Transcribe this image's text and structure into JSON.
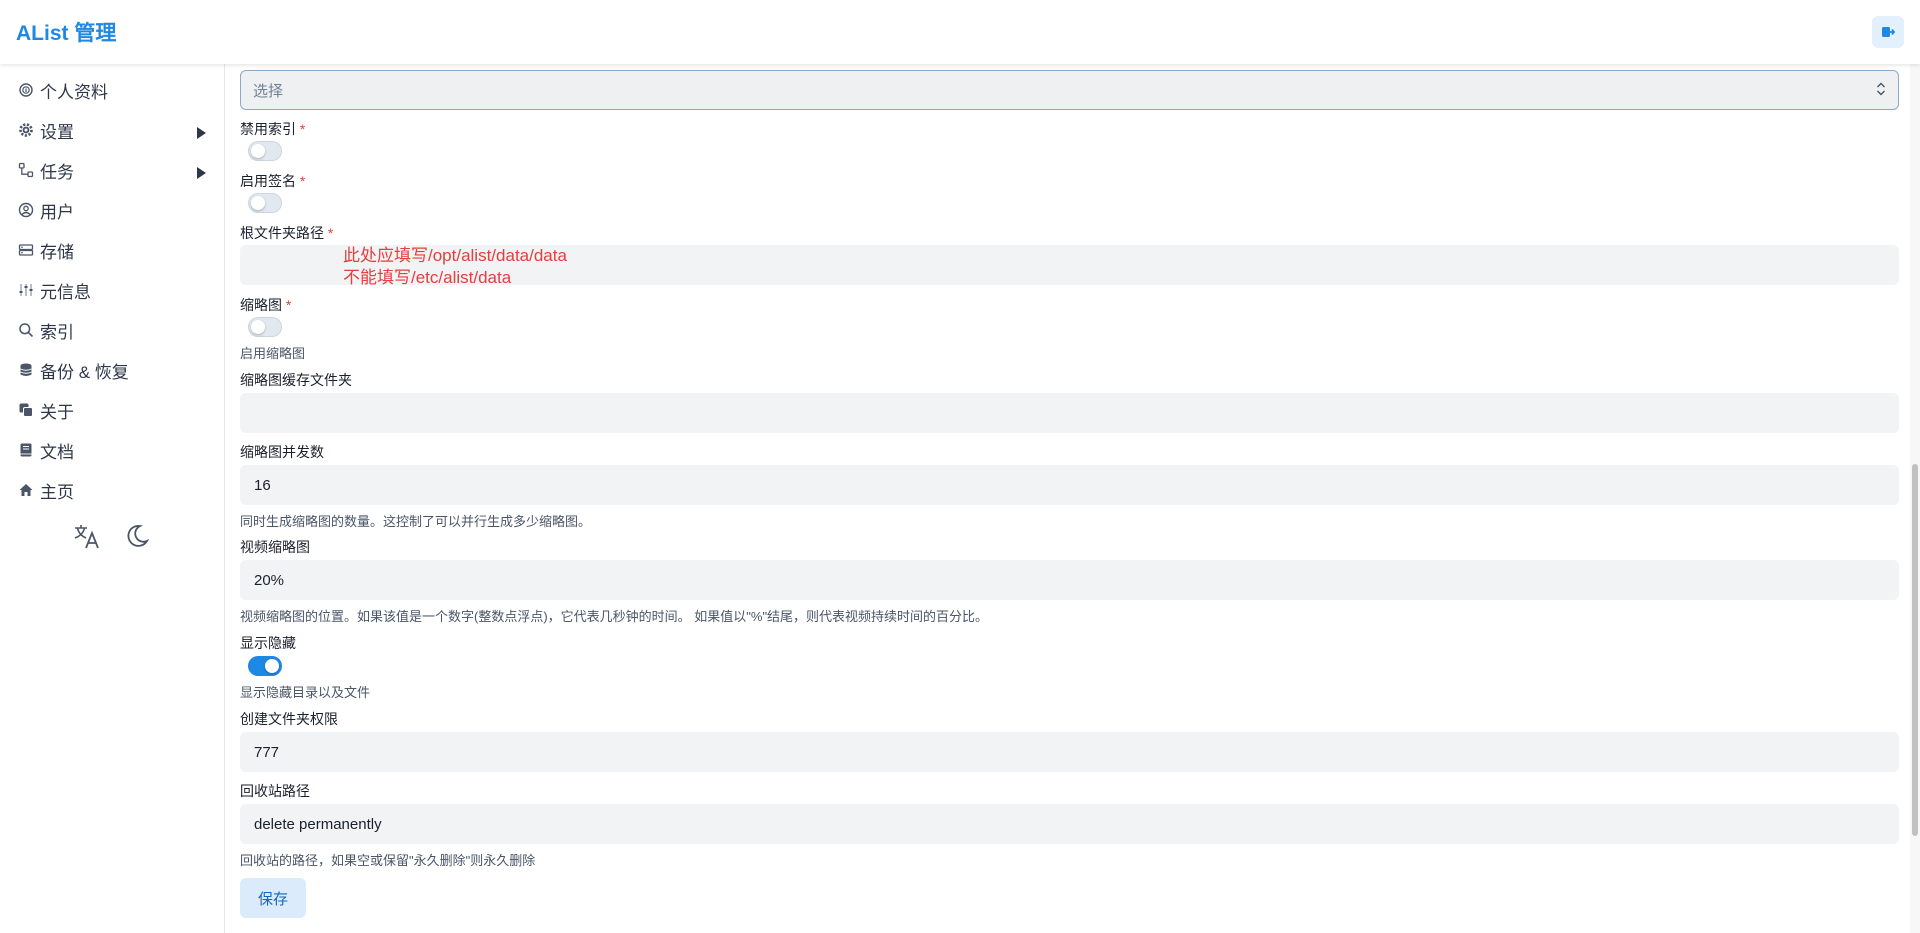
{
  "header": {
    "title": "AList 管理"
  },
  "sidebar": {
    "items": [
      {
        "label": "个人资料",
        "has_arrow": false
      },
      {
        "label": "设置",
        "has_arrow": true
      },
      {
        "label": "任务",
        "has_arrow": true
      },
      {
        "label": "用户",
        "has_arrow": false
      },
      {
        "label": "存储",
        "has_arrow": false
      },
      {
        "label": "元信息",
        "has_arrow": false
      },
      {
        "label": "索引",
        "has_arrow": false
      },
      {
        "label": "备份 & 恢复",
        "has_arrow": false
      },
      {
        "label": "关于",
        "has_arrow": false
      },
      {
        "label": "文档",
        "has_arrow": false
      },
      {
        "label": "主页",
        "has_arrow": false
      }
    ]
  },
  "form": {
    "select_placeholder": "选择",
    "disable_index": {
      "label": "禁用索引",
      "required": "*",
      "enabled": false
    },
    "enable_sign": {
      "label": "启用签名",
      "required": "*",
      "enabled": false
    },
    "root_folder": {
      "label": "根文件夹路径",
      "required": "*",
      "value": "",
      "annotation_line1": "此处应填写/opt/alist/data/data",
      "annotation_line2": "不能填写/etc/alist/data"
    },
    "thumbnail": {
      "label": "缩略图",
      "required": "*",
      "enabled": false,
      "help": "启用缩略图"
    },
    "thumb_cache": {
      "label": "缩略图缓存文件夹",
      "value": ""
    },
    "thumb_concurrency": {
      "label": "缩略图并发数",
      "value": "16",
      "help": "同时生成缩略图的数量。这控制了可以并行生成多少缩略图。"
    },
    "video_thumb": {
      "label": "视频缩略图",
      "value": "20%",
      "help": "视频缩略图的位置。如果该值是一个数字(整数点浮点)，它代表几秒钟的时间。 如果值以\"%\"结尾，则代表视频持续时间的百分比。"
    },
    "show_hidden": {
      "label": "显示隐藏",
      "enabled": true,
      "help": "显示隐藏目录以及文件"
    },
    "mkdir_perm": {
      "label": "创建文件夹权限",
      "value": "777"
    },
    "recycle_path": {
      "label": "回收站路径",
      "value": "delete permanently",
      "help": "回收站的路径，如果空或保留\"永久删除\"则永久删除"
    },
    "save_label": "保存"
  },
  "colors": {
    "accent": "#1e88e5",
    "required": "#e53e3e",
    "annotation": "#e53e3e"
  }
}
